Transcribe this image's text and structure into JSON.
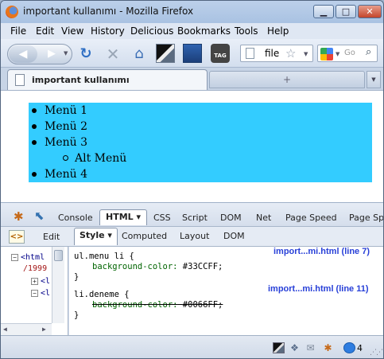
{
  "window": {
    "title": "important kullanımı - Mozilla Firefox",
    "controls": {
      "minimize": "▁",
      "maximize": "□",
      "close": "✕"
    }
  },
  "menubar": [
    "File",
    "Edit",
    "View",
    "History",
    "Delicious",
    "Bookmarks",
    "Tools",
    "Help"
  ],
  "navbar": {
    "url_text": "file",
    "search_placeholder": "Go",
    "icons": [
      "back-icon",
      "forward-icon",
      "reload-icon",
      "stop-icon",
      "home-icon",
      "screen-capture-icon",
      "bookmark-icon",
      "tag-icon"
    ]
  },
  "tab": {
    "title": "important kullanımı",
    "new_tab": "+",
    "list_tabs": "▼"
  },
  "page": {
    "menu_items": [
      "Menü 1",
      "Menü 2",
      "Menü 3",
      "Alt Menü",
      "Menü 4"
    ],
    "menu_background": "#33CCFF"
  },
  "firebug": {
    "main_tabs": [
      "Console",
      "HTML ▾",
      "CSS",
      "Script",
      "DOM",
      "Net",
      "Page Speed",
      "Page Sp"
    ],
    "active_main_tab": "HTML ▾",
    "side_controls": {
      "edit_label": "Edit",
      "tag_icon_text": "<>"
    },
    "sub_tabs": [
      "Style ▾",
      "Computed",
      "Layout",
      "DOM"
    ],
    "active_sub_tab": "Style ▾",
    "html_tree": [
      {
        "toggle": "−",
        "text": "<html"
      },
      {
        "toggle": "",
        "text": "/1999"
      },
      {
        "toggle": "+",
        "text": "<l"
      },
      {
        "toggle": "−",
        "text": "<l"
      }
    ],
    "css_rules": [
      {
        "selector": "ul.menu li {",
        "source": "import...mi.html (line 7)",
        "prop": "background-color:",
        "value": "#33CCFF;",
        "close": "}",
        "overridden": false
      },
      {
        "selector": "li.deneme {",
        "source": "import...mi.html (line 11)",
        "prop": "background-color:",
        "value": "#0066FF;",
        "close": "}",
        "overridden": true
      }
    ]
  },
  "statusbar": {
    "notification_count": "4"
  }
}
